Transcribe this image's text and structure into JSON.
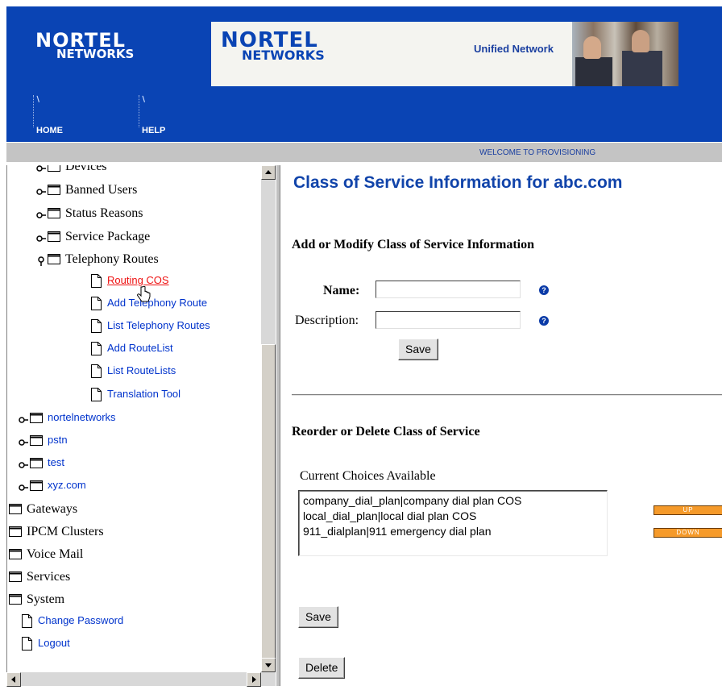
{
  "header": {
    "logo_line1": "NORTEL",
    "logo_line2": "NETWORKS",
    "banner_logo_line1": "NORTEL",
    "banner_logo_line2": "NETWORKS",
    "banner_tagline": "Unified Network",
    "nav": [
      {
        "label": "HOME",
        "icon": "k-mark"
      },
      {
        "label": "HELP",
        "icon": "k-mark"
      }
    ],
    "welcome": "WELCOME TO PROVISIONING"
  },
  "tree": {
    "items": [
      {
        "label": "Devices",
        "type": "folder",
        "style": "serif"
      },
      {
        "label": "Banned Users",
        "type": "folder",
        "style": "serif"
      },
      {
        "label": "Status Reasons",
        "type": "folder",
        "style": "serif"
      },
      {
        "label": "Service Package",
        "type": "folder",
        "style": "serif"
      },
      {
        "label": "Telephony Routes",
        "type": "folder-open",
        "style": "serif"
      },
      {
        "label": "Routing COS",
        "type": "page",
        "style": "link-active"
      },
      {
        "label": "Add Telephony Route",
        "type": "page",
        "style": "link"
      },
      {
        "label": "List Telephony Routes",
        "type": "page",
        "style": "link"
      },
      {
        "label": "Add RouteList",
        "type": "page",
        "style": "link"
      },
      {
        "label": "List RouteLists",
        "type": "page",
        "style": "link"
      },
      {
        "label": "Translation Tool",
        "type": "page",
        "style": "link"
      },
      {
        "label": "nortelnetworks",
        "type": "folder",
        "style": "link"
      },
      {
        "label": "pstn",
        "type": "folder",
        "style": "link"
      },
      {
        "label": "test",
        "type": "folder",
        "style": "link"
      },
      {
        "label": "xyz.com",
        "type": "folder",
        "style": "link"
      },
      {
        "label": "Gateways",
        "type": "folder",
        "style": "serif"
      },
      {
        "label": "IPCM Clusters",
        "type": "folder",
        "style": "serif"
      },
      {
        "label": "Voice Mail",
        "type": "folder",
        "style": "serif"
      },
      {
        "label": "Services",
        "type": "folder",
        "style": "serif"
      },
      {
        "label": "System",
        "type": "folder",
        "style": "serif"
      },
      {
        "label": "Change Password",
        "type": "page",
        "style": "link"
      },
      {
        "label": "Logout",
        "type": "page",
        "style": "link"
      }
    ]
  },
  "main": {
    "title": "Class of Service Information for abc.com",
    "add_section_title": "Add or Modify Class of Service Information",
    "name_label": "Name:",
    "name_value": "",
    "description_label": "Description:",
    "description_value": "",
    "help_icon": "question-mark-icon",
    "save_label": "Save",
    "reorder_section_title": "Reorder or Delete Class of Service",
    "choices_label": "Current Choices Available",
    "choices": [
      "company_dial_plan|company dial plan COS",
      "local_dial_plan|local dial plan COS",
      "911_dialplan|911 emergency dial plan"
    ],
    "up_label": "UP",
    "down_label": "DOWN",
    "save2_label": "Save",
    "delete_label": "Delete"
  },
  "colors": {
    "header_blue": "#0a44b4",
    "title_blue": "#1144aa",
    "link_blue": "#0033cc",
    "active_red": "#ee1111",
    "button_orange": "#f59a2a"
  }
}
